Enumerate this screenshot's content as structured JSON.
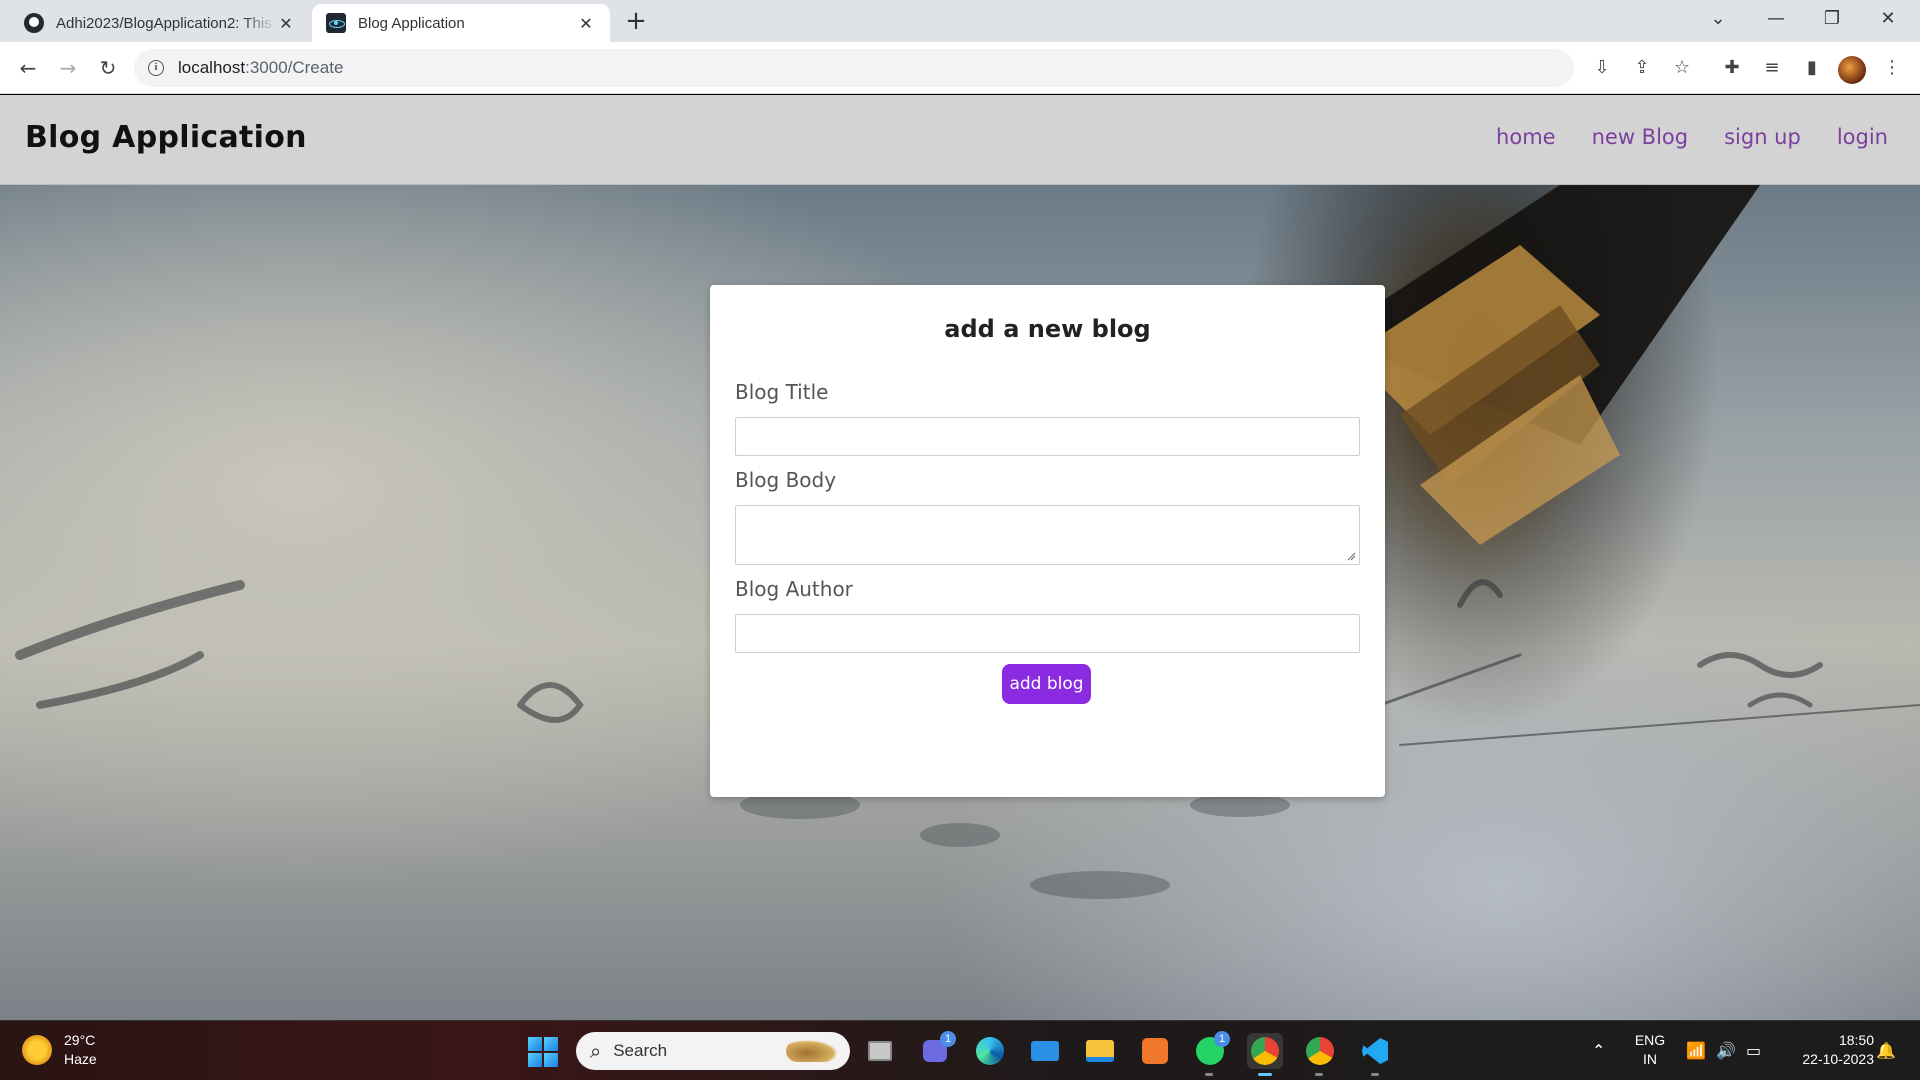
{
  "browser": {
    "tabs": [
      {
        "title": "Adhi2023/BlogApplication2: This",
        "favicon": "github-icon",
        "active": false
      },
      {
        "title": "Blog Application",
        "favicon": "react-icon",
        "active": true
      }
    ],
    "url_host": "localhost",
    "url_path": ":3000/Create"
  },
  "site": {
    "brand": "Blog Application",
    "nav": [
      "home",
      "new Blog",
      "sign up",
      "login"
    ]
  },
  "form": {
    "heading": "add a new blog",
    "title_label": "Blog Title",
    "title_value": "",
    "body_label": "Blog Body",
    "body_value": "",
    "author_label": "Blog Author",
    "author_value": "",
    "submit_label": "add blog"
  },
  "taskbar": {
    "weather_temp": "29°C",
    "weather_desc": "Haze",
    "search_label": "Search",
    "lang_top": "ENG",
    "lang_bottom": "IN",
    "time": "18:50",
    "date": "22-10-2023",
    "teams_badge": "1",
    "whatsapp_badge": "1"
  },
  "colors": {
    "accent": "#8a2be2",
    "nav_link": "#7b3fa0",
    "navbar_bg": "#d3d3d3"
  }
}
